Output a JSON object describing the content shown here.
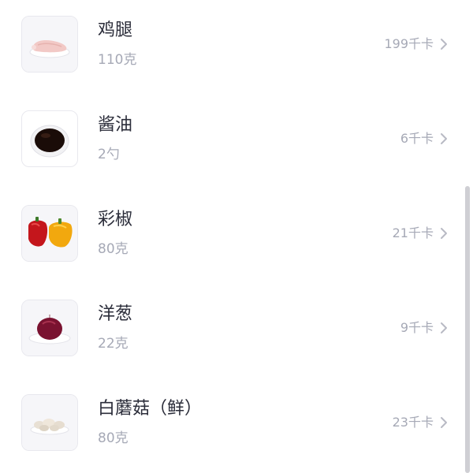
{
  "ingredients": [
    {
      "name": "鸡腿",
      "amount": "110克",
      "kcal": "199千卡",
      "icon": "chicken-leg-icon"
    },
    {
      "name": "酱油",
      "amount": "2勺",
      "kcal": "6千卡",
      "icon": "soy-sauce-icon"
    },
    {
      "name": "彩椒",
      "amount": "80克",
      "kcal": "21千卡",
      "icon": "bell-pepper-icon"
    },
    {
      "name": "洋葱",
      "amount": "22克",
      "kcal": "9千卡",
      "icon": "onion-icon"
    },
    {
      "name": "白蘑菇（鲜）",
      "amount": "80克",
      "kcal": "23千卡",
      "icon": "mushroom-icon"
    }
  ],
  "colors": {
    "title": "#2b2d3a",
    "secondary": "#a6a9b6",
    "chevron": "#b8bac4",
    "thumb_border": "#e8e8ee"
  }
}
